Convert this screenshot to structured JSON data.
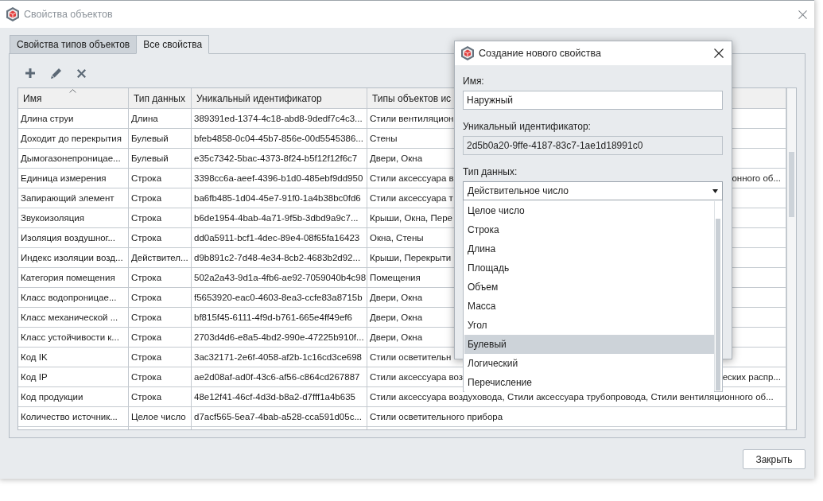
{
  "window": {
    "title": "Свойства объектов"
  },
  "tabs": [
    {
      "label": "Свойства типов объектов",
      "selected": false
    },
    {
      "label": "Все свойства",
      "selected": true
    }
  ],
  "table": {
    "columns": [
      {
        "label": "Имя",
        "sorted": true
      },
      {
        "label": "Тип данных",
        "sorted": false
      },
      {
        "label": "Уникальный идентификатор",
        "sorted": false
      },
      {
        "label": "Типы объектов ис",
        "sorted": false
      }
    ],
    "rows": [
      {
        "cells": [
          "Длина струи",
          "Длина",
          "389391ed-1374-4c18-abd8-9dedf7c4c3...",
          "Стили вентиляцион"
        ]
      },
      {
        "cells": [
          "Доходит до перекрытия",
          "Булевый",
          "bfeb4858-0c04-45b7-856e-00d5545386...",
          "Стены"
        ]
      },
      {
        "cells": [
          "Дымогазонепроницае...",
          "Булевый",
          "e35c7342-5bac-4373-8f24-b5f12f12f6c7",
          "Двери, Окна"
        ]
      },
      {
        "cells": [
          "Единица измерения",
          "Строка",
          "3398cc6a-aeef-4396-b1d0-485ebf9dd950",
          "Стили аксессуара в"
        ],
        "tail": "онного об..."
      },
      {
        "cells": [
          "Запирающий элемент",
          "Строка",
          "ba6fb485-1d04-45e7-91f0-1a4b38bc0fd6",
          "Стили аксессуара т"
        ]
      },
      {
        "cells": [
          "Звукоизоляция",
          "Строка",
          "b6de1954-4bab-4a71-9f5b-3dbd9a9c7...",
          "Крыши, Окна, Пере"
        ]
      },
      {
        "cells": [
          "Изоляция воздушног...",
          "Строка",
          "dd0a5911-bcf1-4dec-89e4-08f65fa16423",
          "Окна, Стены"
        ]
      },
      {
        "cells": [
          "Индекс изоляции возд...",
          "Действител...",
          "d9b891c2-7d48-4e34-8cb2-4683b2d92...",
          "Крыши, Перекрыти"
        ]
      },
      {
        "cells": [
          "Категория помещения",
          "Строка",
          "502a2a43-9d1a-4fb6-ae92-7059040b4c98",
          "Помещения"
        ]
      },
      {
        "cells": [
          "Класс водопроницае...",
          "Строка",
          "f5653920-eac0-4603-8ea3-ccfe83a8715b",
          "Двери, Окна"
        ]
      },
      {
        "cells": [
          "Класс механической ...",
          "Строка",
          "bf815f45-6111-4f9d-b761-665e4ff49ef6",
          "Двери, Окна"
        ]
      },
      {
        "cells": [
          "Класс устойчивости к...",
          "Строка",
          "2703d4d6-e8a5-4bd2-990e-47225b910f...",
          "Двери, Окна"
        ]
      },
      {
        "cells": [
          "Код IK",
          "Строка",
          "3ac32171-2e6f-4058-af2b-1c16cd3ce698",
          "Стили осветительн"
        ]
      },
      {
        "cells": [
          "Код IP",
          "Строка",
          "ae2d08af-ad0f-43c6-af56-c864cd267887",
          "Стили аксессуара воз"
        ],
        "tail": "еских распр..."
      },
      {
        "cells": [
          "Код продукции",
          "Строка",
          "48e12f41-46cf-4d3d-b8a2-d7fff1a4b635",
          "Стили аксессуара воздуховода, Стили аксессуара трубопровода, Стили вентиляционного об..."
        ]
      },
      {
        "cells": [
          "Количество источник...",
          "Целое число",
          "d7acf565-5ea7-4bab-a528-cca591d05c...",
          "Стили осветительного прибора"
        ]
      }
    ]
  },
  "dialog": {
    "title": "Создание нового свойства",
    "fields": [
      {
        "kind": "text",
        "label": "Имя:",
        "value": "Наружный"
      },
      {
        "kind": "readonly",
        "label": "Уникальный идентификатор:",
        "value": "2d5b0a20-9ffe-4187-83c7-1ae1d18991c0"
      },
      {
        "kind": "select",
        "label": "Тип данных:",
        "value": "Действительное число",
        "expanded": true,
        "options": [
          {
            "label": "Целое число",
            "selected": false
          },
          {
            "label": "Строка",
            "selected": false
          },
          {
            "label": "Длина",
            "selected": false
          },
          {
            "label": "Площадь",
            "selected": false
          },
          {
            "label": "Объем",
            "selected": false
          },
          {
            "label": "Масса",
            "selected": false
          },
          {
            "label": "Угол",
            "selected": false
          },
          {
            "label": "Булевый",
            "selected": true
          },
          {
            "label": "Логический",
            "selected": false
          },
          {
            "label": "Перечисление",
            "selected": false
          }
        ]
      }
    ]
  },
  "buttons": [
    "Закрыть"
  ]
}
